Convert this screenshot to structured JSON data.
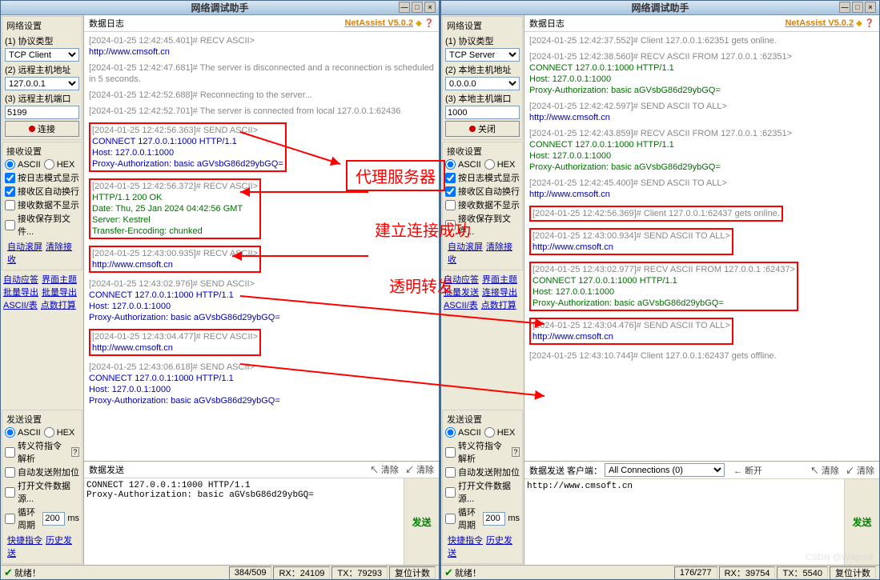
{
  "app_title": "网络调试助手",
  "brand": "NetAssist V5.0.2",
  "left": {
    "net": {
      "title": "网络设置",
      "proto_label": "(1) 协议类型",
      "proto_value": "TCP Client",
      "host_label": "(2) 远程主机地址",
      "host_value": "127.0.0.1",
      "port_label": "(3) 远程主机端口",
      "port_value": "5199",
      "connect_btn": "连接"
    },
    "recv": {
      "title": "接收设置",
      "ascii": "ASCII",
      "hex": "HEX",
      "c1": "按日志模式显示",
      "c2": "接收区自动换行",
      "c3": "接收数据不显示",
      "c4": "接收保存到文件...",
      "link_a": "自动滚屏",
      "link_b": "清除接收"
    },
    "auto": {
      "l1a": "自动应答",
      "l1b": "界面主题",
      "l2a": "批量导出",
      "l2b": "批量导出",
      "l3a": "ASCII/表",
      "l3b": "点数打算"
    },
    "send": {
      "title": "发送设置",
      "ascii": "ASCII",
      "hex": "HEX",
      "c1": "转义符指令解析 ",
      "c2": "自动发送附加位",
      "c3": "打开文件数据源...",
      "loop": "循环周期",
      "loop_val": "200",
      "loop_unit": "ms",
      "link_a": "快捷指令",
      "link_b": "历史发送"
    },
    "log_title": "数据日志",
    "log": [
      {
        "cls": "",
        "lines": [
          [
            "gray",
            "[2024-01-25 12:42:45.401]# RECV ASCII>"
          ],
          [
            "blue",
            "http://www.cmsoft.cn"
          ]
        ]
      },
      {
        "cls": "",
        "lines": [
          [
            "gray",
            "[2024-01-25 12:42:47.681]# The server is disconnected and a reconnection is scheduled in 5 seconds."
          ]
        ]
      },
      {
        "cls": "",
        "lines": [
          [
            "gray",
            "[2024-01-25 12:42:52.688]# Reconnecting to the server..."
          ]
        ]
      },
      {
        "cls": "",
        "lines": [
          [
            "gray",
            "[2024-01-25 12:42:52.701]# The server is connected from local 127.0.0.1:62436"
          ]
        ]
      },
      {
        "cls": "redbox",
        "lines": [
          [
            "gray",
            "[2024-01-25 12:42:56.363]# SEND ASCII>"
          ],
          [
            "blue",
            "CONNECT 127.0.0.1:1000 HTTP/1.1"
          ],
          [
            "blue",
            "Host: 127.0.0.1:1000"
          ],
          [
            "blue",
            "Proxy-Authorization: basic aGVsbG86d29ybGQ="
          ]
        ]
      },
      {
        "cls": "redbox",
        "lines": [
          [
            "gray",
            "[2024-01-25 12:42:56.372]# RECV ASCII>"
          ],
          [
            "green",
            "HTTP/1.1 200 OK"
          ],
          [
            "green",
            "Date: Thu, 25 Jan 2024 04:42:56 GMT"
          ],
          [
            "green",
            "Server: Kestrel"
          ],
          [
            "green",
            "Transfer-Encoding: chunked"
          ]
        ]
      },
      {
        "cls": "redbox",
        "lines": [
          [
            "gray",
            "[2024-01-25 12:43:00.935]# RECV ASCII>"
          ],
          [
            "blue",
            "http://www.cmsoft.cn"
          ]
        ]
      },
      {
        "cls": "",
        "lines": [
          [
            "gray",
            "[2024-01-25 12:43:02.976]# SEND ASCII>"
          ],
          [
            "blue",
            "CONNECT 127.0.0.1:1000 HTTP/1.1"
          ],
          [
            "blue",
            "Host: 127.0.0.1:1000"
          ],
          [
            "blue",
            "Proxy-Authorization: basic aGVsbG86d29ybGQ="
          ]
        ]
      },
      {
        "cls": "redbox",
        "lines": [
          [
            "gray",
            "[2024-01-25 12:43:04.477]# RECV ASCII>"
          ],
          [
            "blue",
            "http://www.cmsoft.cn"
          ]
        ]
      },
      {
        "cls": "",
        "lines": [
          [
            "gray",
            "[2024-01-25 12:43:06.618]# SEND ASCII>"
          ],
          [
            "blue",
            "CONNECT 127.0.0.1:1000 HTTP/1.1"
          ],
          [
            "blue",
            "Host: 127.0.0.1:1000"
          ],
          [
            "blue",
            "Proxy-Authorization: basic aGVsbG86d29ybGQ="
          ]
        ]
      }
    ],
    "send_title": "数据发送",
    "send_clear": "↖ 清除",
    "send_clear2": "↙ 清除",
    "send_text": "CONNECT 127.0.0.1:1000 HTTP/1.1\nProxy-Authorization: basic aGVsbG86d29ybGQ=",
    "send_btn": "发送",
    "status": {
      "ready": "就绪！",
      "cnt": "384/509",
      "rx": "RX：24109",
      "tx": "TX：79293",
      "reset": "复位计数"
    }
  },
  "right": {
    "net": {
      "title": "网络设置",
      "proto_label": "(1) 协议类型",
      "proto_value": "TCP Server",
      "host_label": "(2) 本地主机地址",
      "host_value": "0.0.0.0",
      "port_label": "(3) 本地主机端口",
      "port_value": "1000",
      "close_btn": "关闭"
    },
    "recv": {
      "title": "接收设置",
      "ascii": "ASCII",
      "hex": "HEX",
      "c1": "按日志模式显示",
      "c2": "接收区自动换行",
      "c3": "接收数据不显示",
      "c4": "接收保存到文件...",
      "link_a": "自动滚屏",
      "link_b": "清除接收"
    },
    "auto": {
      "l1a": "自动应答",
      "l1b": "界面主题",
      "l2a": "批量发送",
      "l2b": "连接导出",
      "l3a": "ASCII/表",
      "l3b": "点数打算"
    },
    "send": {
      "title": "发送设置",
      "ascii": "ASCII",
      "hex": "HEX",
      "c1": "转义符指令解析 ",
      "c2": "自动发送附加位",
      "c3": "打开文件数据源...",
      "loop": "循环周期",
      "loop_val": "200",
      "loop_unit": "ms",
      "link_a": "快捷指令",
      "link_b": "历史发送"
    },
    "log_title": "数据日志",
    "log": [
      {
        "cls": "",
        "lines": [
          [
            "gray",
            "[2024-01-25 12:42:37.552]# Client 127.0.0.1:62351 gets online."
          ]
        ]
      },
      {
        "cls": "",
        "lines": [
          [
            "gray",
            "[2024-01-25 12:42:38.560]# RECV ASCII FROM 127.0.0.1 :62351>"
          ],
          [
            "green",
            "CONNECT 127.0.0.1:1000 HTTP/1.1"
          ],
          [
            "green",
            "Host: 127.0.0.1:1000"
          ],
          [
            "green",
            "Proxy-Authorization: basic aGVsbG86d29ybGQ="
          ]
        ]
      },
      {
        "cls": "",
        "lines": [
          [
            "gray",
            "[2024-01-25 12:42:42.597]# SEND ASCII TO ALL>"
          ],
          [
            "blue",
            "http://www.cmsoft.cn"
          ]
        ]
      },
      {
        "cls": "",
        "lines": [
          [
            "gray",
            "[2024-01-25 12:42:43.859]# RECV ASCII FROM 127.0.0.1 :62351>"
          ],
          [
            "green",
            "CONNECT 127.0.0.1:1000 HTTP/1.1"
          ],
          [
            "green",
            "Host: 127.0.0.1:1000"
          ],
          [
            "green",
            "Proxy-Authorization: basic aGVsbG86d29ybGQ="
          ]
        ]
      },
      {
        "cls": "",
        "lines": [
          [
            "gray",
            "[2024-01-25 12:42:45.400]# SEND ASCII TO ALL>"
          ],
          [
            "blue",
            "http://www.cmsoft.cn"
          ]
        ]
      },
      {
        "cls": "redbox",
        "lines": [
          [
            "gray",
            "[2024-01-25 12:42:56.369]# Client 127.0.0.1:62437 gets online."
          ]
        ]
      },
      {
        "cls": "redbox",
        "lines": [
          [
            "gray",
            "[2024-01-25 12:43:00.934]# SEND ASCII TO ALL>"
          ],
          [
            "blue",
            "http://www.cmsoft.cn"
          ]
        ]
      },
      {
        "cls": "redbox",
        "lines": [
          [
            "gray",
            "[2024-01-25 12:43:02.977]# RECV ASCII FROM 127.0.0.1 :62437>"
          ],
          [
            "green",
            "CONNECT 127.0.0.1:1000 HTTP/1.1"
          ],
          [
            "green",
            "Host: 127.0.0.1:1000"
          ],
          [
            "green",
            "Proxy-Authorization: basic aGVsbG86d29ybGQ="
          ]
        ]
      },
      {
        "cls": "redbox",
        "lines": [
          [
            "gray",
            "[2024-01-25 12:43:04.476]# SEND ASCII TO ALL>"
          ],
          [
            "blue",
            "http://www.cmsoft.cn"
          ]
        ]
      },
      {
        "cls": "",
        "lines": [
          [
            "gray",
            "[2024-01-25 12:43:10.744]# Client 127.0.0.1:62437 gets offline."
          ]
        ]
      }
    ],
    "send_title": "数据发送",
    "client_lbl": "客户端：",
    "conn_sel": "All Connections (0)",
    "disconnect": "← 断开",
    "send_clear": "↖ 清除",
    "send_clear2": "↙ 清除",
    "send_text": "http://www.cmsoft.cn",
    "send_btn": "发送",
    "status": {
      "ready": "就绪！",
      "cnt": "176/277",
      "rx": "RX：39754",
      "tx": "TX：5540",
      "reset": "复位计数"
    }
  },
  "annotations": {
    "proxy": "代理服务器",
    "conn_ok": "建立连接成功",
    "transparent": "透明转发"
  },
  "watermark": "CSDN @Wagsn8"
}
